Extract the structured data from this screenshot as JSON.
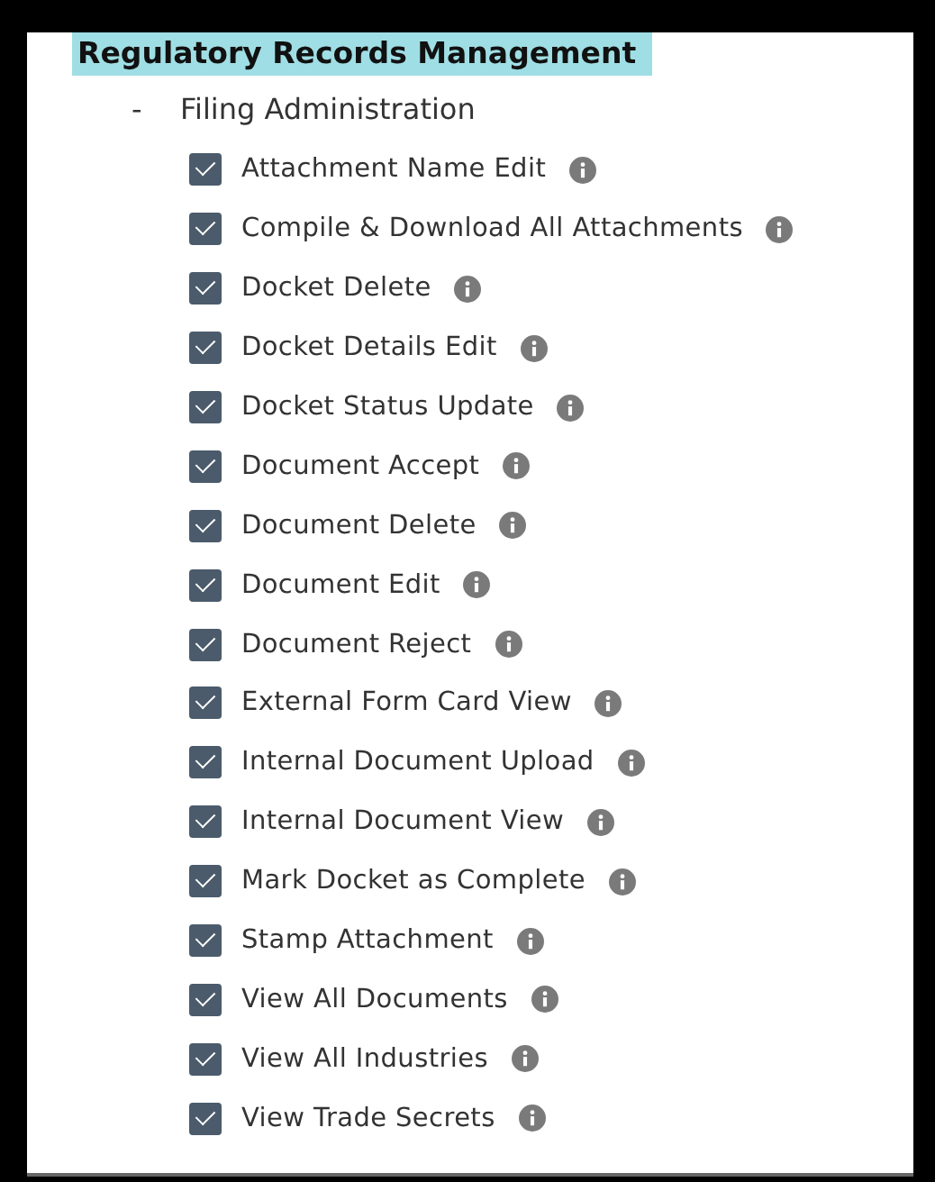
{
  "section": {
    "title": "Regulatory Records Management",
    "groups": [
      {
        "toggle": "-",
        "label": "Filing Administration",
        "children": [
          {
            "label": "Attachment Name Edit",
            "checked": true
          },
          {
            "label": "Compile & Download All Attachments",
            "checked": true
          },
          {
            "label": "Docket Delete",
            "checked": true
          },
          {
            "label": "Docket Details Edit",
            "checked": true
          },
          {
            "label": "Docket Status Update",
            "checked": true
          },
          {
            "label": "Document Accept",
            "checked": true
          },
          {
            "label": "Document Delete",
            "checked": true
          },
          {
            "label": "Document Edit",
            "checked": true
          },
          {
            "label": "Document Reject",
            "checked": true
          },
          {
            "label": "External Form Card View",
            "checked": true
          },
          {
            "label": "Internal Document Upload",
            "checked": true
          },
          {
            "label": "Internal Document View",
            "checked": true
          },
          {
            "label": "Mark Docket as Complete",
            "checked": true
          },
          {
            "label": "Stamp Attachment",
            "checked": true
          },
          {
            "label": "View All Documents",
            "checked": true
          },
          {
            "label": "View All Industries",
            "checked": true
          },
          {
            "label": "View Trade Secrets",
            "checked": true
          }
        ]
      }
    ]
  }
}
